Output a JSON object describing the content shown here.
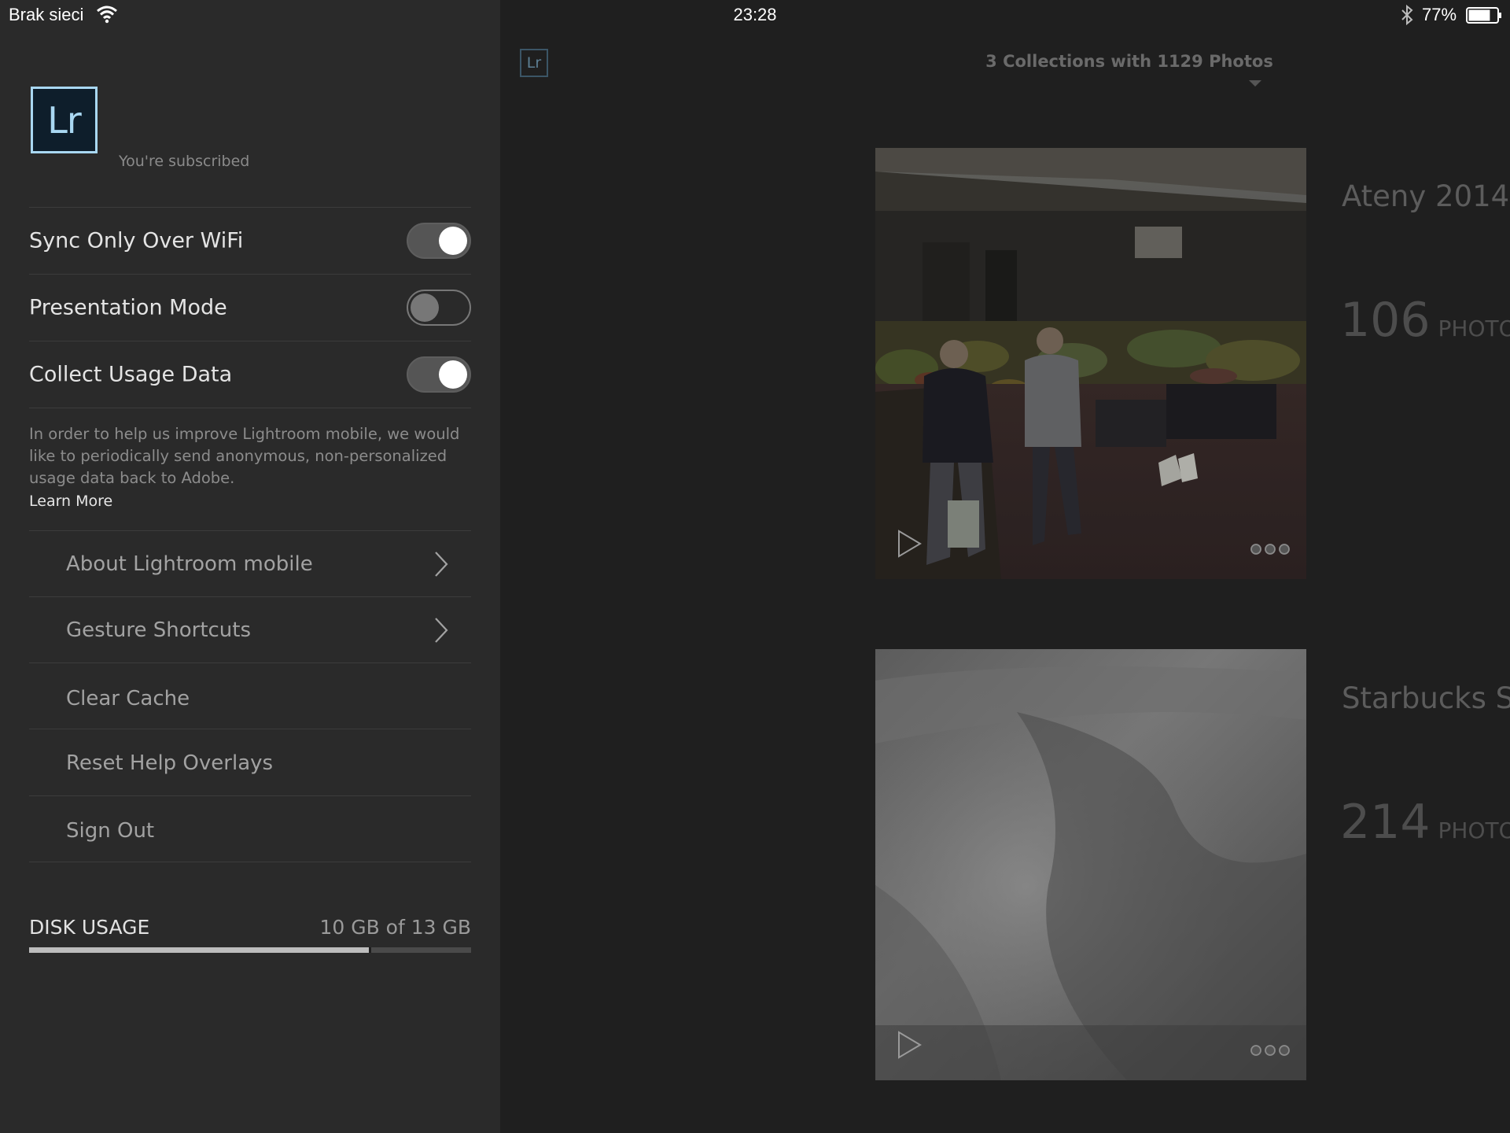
{
  "status_bar": {
    "carrier": "Brak sieci",
    "time": "23:28",
    "battery_percent": "77%",
    "battery_level": 0.77
  },
  "settings_panel": {
    "logo_text": "Lr",
    "subscription_status": "You're subscribed",
    "toggles": [
      {
        "label": "Sync Only Over WiFi",
        "on": true
      },
      {
        "label": "Presentation Mode",
        "on": false
      },
      {
        "label": "Collect Usage Data",
        "on": true
      }
    ],
    "usage_note": "In order to help us improve Lightroom mobile, we would like to periodically send anonymous, non-personalized usage data back to Adobe.",
    "learn_more": "Learn More",
    "menu_items": [
      {
        "label": "About Lightroom mobile",
        "has_chevron": true
      },
      {
        "label": "Gesture Shortcuts",
        "has_chevron": true
      },
      {
        "label": "Clear Cache",
        "has_chevron": false
      },
      {
        "label": "Reset Help Overlays",
        "has_chevron": false
      },
      {
        "label": "Sign Out",
        "has_chevron": false
      }
    ],
    "disk_usage": {
      "label": "DISK USAGE",
      "value": "10 GB of 13 GB",
      "fraction": 0.769
    }
  },
  "main": {
    "logo_text": "Lr",
    "title": "3 Collections with 1129 Photos",
    "collections": [
      {
        "name": "Ateny 2014",
        "count": "106",
        "unit": "PHOTOS",
        "thumbnail": "market-photo"
      },
      {
        "name": "Starbucks Spri",
        "count": "214",
        "unit": "PHOTOS",
        "thumbnail": "long-exposure-water-photo"
      }
    ]
  },
  "colors": {
    "panel_bg": "#2a2a2a",
    "main_bg": "#1f1f1f",
    "lr_blue": "#a9d8f2"
  }
}
